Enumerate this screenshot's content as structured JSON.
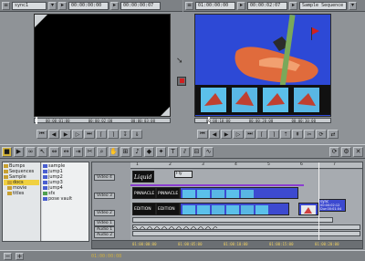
{
  "source_bar": {
    "clip_name": "sync1",
    "tc_in": "00:00:00:00",
    "tc_out": "00:00:00:07"
  },
  "record_bar": {
    "tc_in": "01:00:00:00",
    "tc_dur": "00:00:02:07",
    "sequence_name": "Sample Sequence"
  },
  "source_ruler": [
    "00:00:01:00",
    "00:00:02:00",
    "00:00:03:00"
  ],
  "record_ruler": [
    "00:00:10:00",
    "00:00:20:00",
    "00:00:30:00"
  ],
  "bin": {
    "tree": [
      "Bumps",
      "Sequences",
      "Sample",
      "docs",
      "movie",
      "titles"
    ],
    "list": [
      "sample",
      "jump1",
      "jump2",
      "jump3",
      "jump4",
      "sfx",
      "pose vault"
    ]
  },
  "timeline": {
    "ruler_marks": [
      "1",
      "2",
      "3",
      "4",
      "5",
      "6",
      "7"
    ],
    "tracks": [
      {
        "label": "Video 4"
      },
      {
        "label": "Video 3"
      },
      {
        "label": "Video 2"
      },
      {
        "label": "Video 1"
      },
      {
        "label": "Audio 1"
      },
      {
        "label": "Audio 2"
      },
      {
        "label": "Audio 3"
      }
    ],
    "clip_title_label": "Liquid",
    "clip_fx_label": "Fly",
    "clip_pinnacle_1": "PINNACLE",
    "clip_pinnacle_2": "PINNACLE",
    "clip_edition_1": "EDITION",
    "clip_edition_2": "EDITION",
    "clip_info_name": "sync",
    "clip_info_tc": "00:00:02:12",
    "clip_info_dur": "Dur:00:01:04",
    "bottom_tcs": [
      "01:00:00:00",
      "01:00:05:00",
      "01:00:10:00",
      "01:00:15:00",
      "01:00:20:00"
    ]
  },
  "status": {
    "master_tc": "01:00:00:08"
  },
  "colors": {
    "video_clip": "#3d4ad0",
    "audio_wave": "#1a1a1a",
    "tl_highlight": "#8b3dd0"
  }
}
